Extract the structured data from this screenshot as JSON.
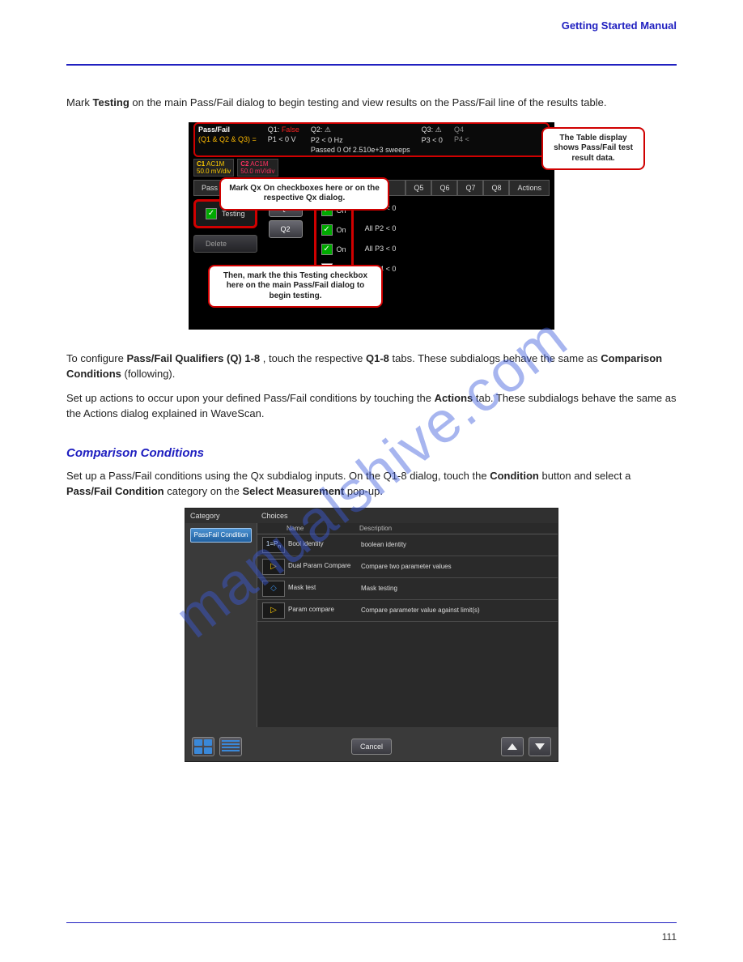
{
  "header": {
    "title": "Getting Started Manual"
  },
  "footer": {
    "page": "111"
  },
  "watermark": "manualshive.com",
  "body": {
    "intro1": {
      "pre": "Mark ",
      "bold": "Testing",
      "post": " on the main Pass/Fail dialog to begin testing and view results on the Pass/Fail line of the results table."
    },
    "configure": {
      "pre": "To configure ",
      "bold1": "Pass/Fail Qualifiers (Q) 1-8",
      "mid1": ", touch the respective ",
      "bold2": "Q1-8",
      "mid2": " tabs. These subdialogs behave the same as ",
      "bold3": "Comparison Conditions",
      "post": " (following)."
    },
    "actions": {
      "pre": "Set up actions to occur upon your defined Pass/Fail conditions by touching the ",
      "bold": "Actions",
      "post": " tab. These subdialogs behave the same as the Actions dialog explained in WaveScan."
    },
    "comparison": {
      "pre": "Set up a Pass/Fail conditions using the Qx subdialog inputs. On the Q1-8 dialog, touch the ",
      "bold1": "Condition",
      "mid1": " button and select a ",
      "bold2": "Pass/Fail Condition",
      "mid2": " category on the ",
      "bold3": "Select Measurement",
      "post": " pop-up."
    }
  },
  "section": {
    "title": "Comparison Conditions"
  },
  "osc": {
    "top": {
      "passfail": "Pass/Fail",
      "expr": "(Q1 & Q2 & Q3) =",
      "q1": {
        "name": "Q1:",
        "status": "False",
        "cond": "P1 < 0 V"
      },
      "q2": {
        "name": "Q2: ⚠",
        "cond": "P2 < 0 Hz"
      },
      "q3": {
        "name": "Q3: ⚠",
        "cond": "P3 < 0"
      },
      "q4": {
        "name": "Q4",
        "cond": "P4 <"
      },
      "passedline": "Passed 0   Of   2.510e+3   sweeps"
    },
    "ch": {
      "c1": {
        "name": "C1",
        "mode": "AC1M",
        "scale": "50.0 mV/div"
      },
      "c2": {
        "name": "C2",
        "mode": "AC1M",
        "scale": "50.0 mV/div"
      }
    },
    "tabs": [
      "Pass",
      "Q5",
      "Q6",
      "Q7",
      "Q8",
      "Actions"
    ],
    "testingLabel": "Testing",
    "deleteLabel": "Delete",
    "qbuttons": [
      "Q1",
      "Q2"
    ],
    "onLabel": "On",
    "conds": [
      "All P1 < 0",
      "All P2 < 0",
      "All P3 < 0",
      "All P4 < 0"
    ],
    "callouts": {
      "table": "The Table display shows Pass/Fail test result data.",
      "qxon": "Mark Qx On checkboxes here or on the respective Qx dialog.",
      "testing": "Then, mark the this Testing checkbox here on the main Pass/Fail dialog to begin testing."
    }
  },
  "dialog": {
    "categoryHeader": "Category",
    "choicesHeader": "Choices",
    "category": "PassFail Condition",
    "cols": {
      "name": "Name",
      "desc": "Description"
    },
    "rows": [
      {
        "name": "Bool identity",
        "desc": "boolean identity"
      },
      {
        "name": "Dual Param Compare",
        "desc": "Compare two parameter values"
      },
      {
        "name": "Mask test",
        "desc": "Mask testing"
      },
      {
        "name": "Param compare",
        "desc": "Compare parameter value against limit(s)"
      }
    ],
    "cancel": "Cancel"
  }
}
